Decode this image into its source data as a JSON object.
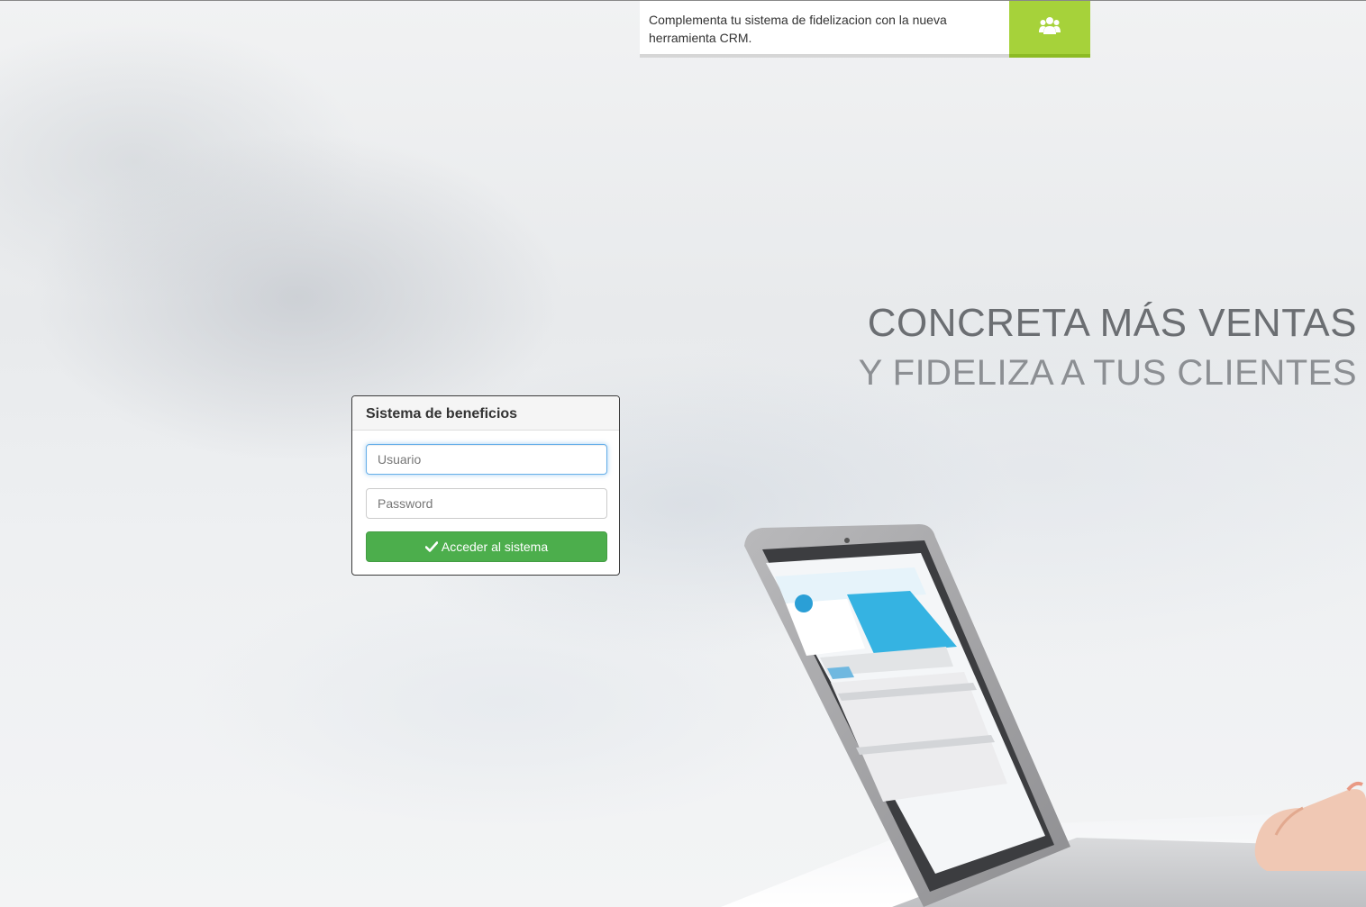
{
  "promo": {
    "text": "Complementa tu sistema de fidelizacion con la nueva herramienta CRM.",
    "icon": "users-icon",
    "accent_color": "#a6d23a"
  },
  "hero": {
    "line1": "CONCRETA MÁS VENTAS",
    "line2": "Y FIDELIZA A TUS CLIENTES"
  },
  "login": {
    "title": "Sistema de beneficios",
    "username_placeholder": "Usuario",
    "password_placeholder": "Password",
    "submit_label": "Acceder al sistema",
    "submit_icon": "check-icon",
    "submit_color": "#4cae4c"
  }
}
